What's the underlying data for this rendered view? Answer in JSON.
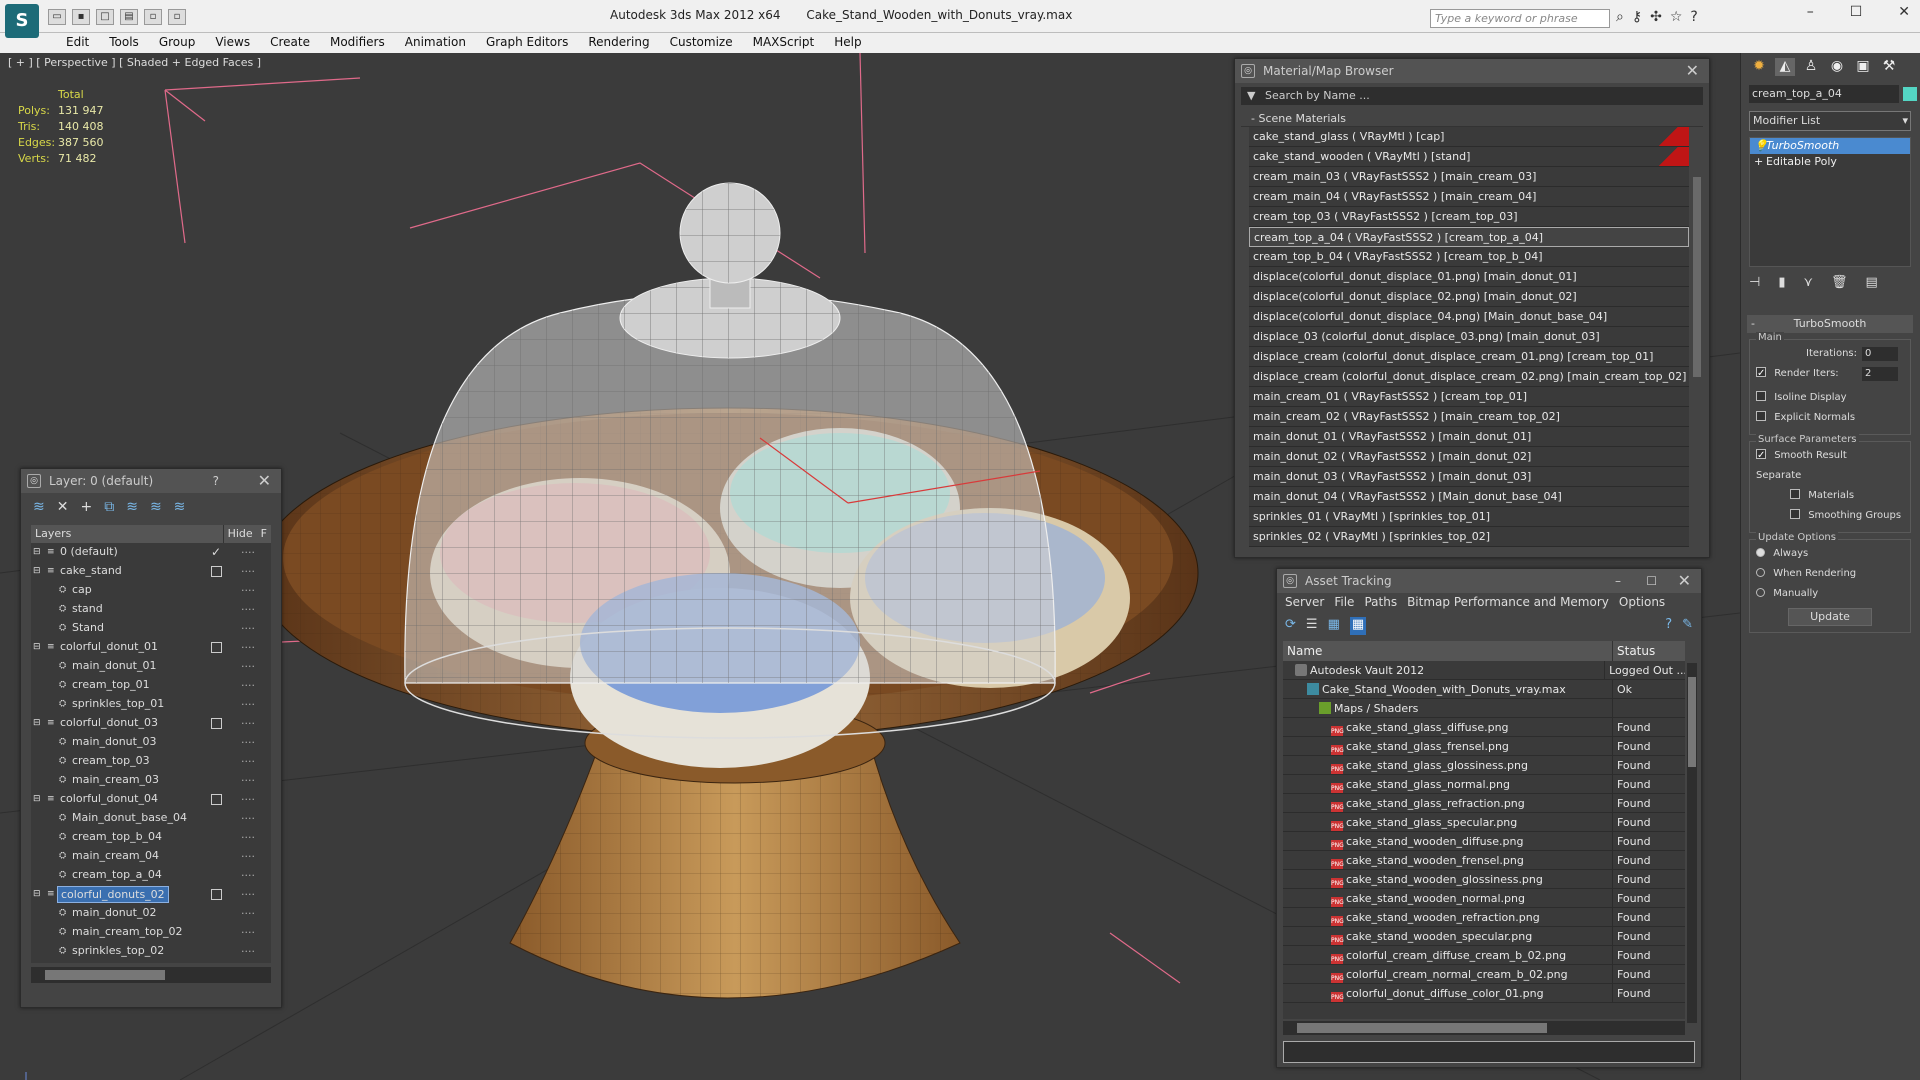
{
  "app": {
    "logo": "S",
    "title": "Autodesk 3ds Max  2012 x64",
    "file": "Cake_Stand_Wooden_with_Donuts_vray.max",
    "search_placeholder": "Type a keyword or phrase"
  },
  "menu": [
    "Edit",
    "Tools",
    "Group",
    "Views",
    "Create",
    "Modifiers",
    "Animation",
    "Graph Editors",
    "Rendering",
    "Customize",
    "MAXScript",
    "Help"
  ],
  "viewport": {
    "label": "[ + ] [ Perspective ] [ Shaded + Edged Faces ]",
    "stats_header": "Total",
    "stats": [
      {
        "key": "Polys:",
        "value": "131 947"
      },
      {
        "key": "Tris:",
        "value": "140 408"
      },
      {
        "key": "Edges:",
        "value": "387 560"
      },
      {
        "key": "Verts:",
        "value": "71 482"
      }
    ]
  },
  "material_browser": {
    "title": "Material/Map Browser",
    "search": "Search by Name ...",
    "section": "Scene Materials",
    "items": [
      "cake_stand_glass  ( VRayMtl )  [cap]",
      "cake_stand_wooden  ( VRayMtl )  [stand]",
      "cream_main_03  ( VRayFastSSS2 )  [main_cream_03]",
      "cream_main_04  ( VRayFastSSS2 )  [main_cream_04]",
      "cream_top_03  ( VRayFastSSS2 )  [cream_top_03]",
      "cream_top_a_04  ( VRayFastSSS2 )  [cream_top_a_04]",
      "cream_top_b_04  ( VRayFastSSS2 )  [cream_top_b_04]",
      "displace(colorful_donut_displace_01.png) [main_donut_01]",
      "displace(colorful_donut_displace_02.png) [main_donut_02]",
      "displace(colorful_donut_displace_04.png) [Main_donut_base_04]",
      "displace_03 (colorful_donut_displace_03.png) [main_donut_03]",
      "displace_cream (colorful_donut_displace_cream_01.png) [cream_top_01]",
      "displace_cream (colorful_donut_displace_cream_02.png) [main_cream_top_02]",
      "main_cream_01  ( VRayFastSSS2 )  [cream_top_01]",
      "main_cream_02  ( VRayFastSSS2 )  [main_cream_top_02]",
      "main_donut_01  ( VRayFastSSS2 )  [main_donut_01]",
      "main_donut_02  ( VRayFastSSS2 )  [main_donut_02]",
      "main_donut_03  ( VRayFastSSS2 )  [main_donut_03]",
      "main_donut_04  ( VRayFastSSS2 )  [Main_donut_base_04]",
      "sprinkles_01  ( VRayMtl )  [sprinkles_top_01]",
      "sprinkles_02  ( VRayMtl )  [sprinkles_top_02]"
    ]
  },
  "layers": {
    "title": "Layer: 0 (default)",
    "help": "?",
    "columns": [
      "Layers",
      "Hide",
      "F"
    ],
    "rows": [
      {
        "name": "0 (default)",
        "level": 0,
        "check": true
      },
      {
        "name": "cake_stand",
        "level": 0,
        "box": true
      },
      {
        "name": "cap",
        "level": 1
      },
      {
        "name": "stand",
        "level": 1
      },
      {
        "name": "Stand",
        "level": 1
      },
      {
        "name": "colorful_donut_01",
        "level": 0,
        "box": true
      },
      {
        "name": "main_donut_01",
        "level": 1
      },
      {
        "name": "cream_top_01",
        "level": 1
      },
      {
        "name": "sprinkles_top_01",
        "level": 1
      },
      {
        "name": "colorful_donut_03",
        "level": 0,
        "box": true
      },
      {
        "name": "main_donut_03",
        "level": 1
      },
      {
        "name": "cream_top_03",
        "level": 1
      },
      {
        "name": "main_cream_03",
        "level": 1
      },
      {
        "name": "colorful_donut_04",
        "level": 0,
        "box": true
      },
      {
        "name": "Main_donut_base_04",
        "level": 1
      },
      {
        "name": "cream_top_b_04",
        "level": 1
      },
      {
        "name": "main_cream_04",
        "level": 1
      },
      {
        "name": "cream_top_a_04",
        "level": 1
      },
      {
        "name": "colorful_donuts_02",
        "level": 0,
        "box": true,
        "selected": true
      },
      {
        "name": "main_donut_02",
        "level": 1
      },
      {
        "name": "main_cream_top_02",
        "level": 1
      },
      {
        "name": "sprinkles_top_02",
        "level": 1
      }
    ]
  },
  "asset_tracking": {
    "title": "Asset Tracking",
    "menu": [
      "Server",
      "File",
      "Paths",
      "Bitmap Performance and Memory",
      "Options"
    ],
    "columns": [
      "Name",
      "Status"
    ],
    "rows": [
      {
        "name": "Autodesk Vault 2012",
        "status": "Logged Out ...",
        "icon": "vault",
        "indent": 1
      },
      {
        "name": "Cake_Stand_Wooden_with_Donuts_vray.max",
        "status": "Ok",
        "icon": "max",
        "indent": 2
      },
      {
        "name": "Maps / Shaders",
        "status": "",
        "icon": "folder",
        "indent": 3
      },
      {
        "name": "cake_stand_glass_diffuse.png",
        "status": "Found",
        "icon": "png",
        "indent": 4
      },
      {
        "name": "cake_stand_glass_frensel.png",
        "status": "Found",
        "icon": "png",
        "indent": 4
      },
      {
        "name": "cake_stand_glass_glossiness.png",
        "status": "Found",
        "icon": "png",
        "indent": 4
      },
      {
        "name": "cake_stand_glass_normal.png",
        "status": "Found",
        "icon": "png",
        "indent": 4
      },
      {
        "name": "cake_stand_glass_refraction.png",
        "status": "Found",
        "icon": "png",
        "indent": 4
      },
      {
        "name": "cake_stand_glass_specular.png",
        "status": "Found",
        "icon": "png",
        "indent": 4
      },
      {
        "name": "cake_stand_wooden_diffuse.png",
        "status": "Found",
        "icon": "png",
        "indent": 4
      },
      {
        "name": "cake_stand_wooden_frensel.png",
        "status": "Found",
        "icon": "png",
        "indent": 4
      },
      {
        "name": "cake_stand_wooden_glossiness.png",
        "status": "Found",
        "icon": "png",
        "indent": 4
      },
      {
        "name": "cake_stand_wooden_normal.png",
        "status": "Found",
        "icon": "png",
        "indent": 4
      },
      {
        "name": "cake_stand_wooden_refraction.png",
        "status": "Found",
        "icon": "png",
        "indent": 4
      },
      {
        "name": "cake_stand_wooden_specular.png",
        "status": "Found",
        "icon": "png",
        "indent": 4
      },
      {
        "name": "colorful_cream_diffuse_cream_b_02.png",
        "status": "Found",
        "icon": "png",
        "indent": 4
      },
      {
        "name": "colorful_cream_normal_cream_b_02.png",
        "status": "Found",
        "icon": "png",
        "indent": 4
      },
      {
        "name": "colorful_donut_diffuse_color_01.png",
        "status": "Found",
        "icon": "png",
        "indent": 4
      }
    ]
  },
  "command_panel": {
    "object_name": "cream_top_a_04",
    "object_color": "#54d6c4",
    "modifier_list": "Modifier List",
    "stack": [
      {
        "name": "TurboSmooth",
        "selected": true
      },
      {
        "name": "Editable Poly",
        "selected": false
      }
    ],
    "rollout_title": "TurboSmooth",
    "main_group": "Main",
    "iterations_label": "Iterations:",
    "iterations_value": "0",
    "render_iters_label": "Render Iters:",
    "render_iters_value": "2",
    "isoline": "Isoline Display",
    "explicit_normals": "Explicit Normals",
    "surface_group": "Surface Parameters",
    "smooth_result": "Smooth Result",
    "separate": "Separate",
    "materials": "Materials",
    "smoothing_groups": "Smoothing Groups",
    "update_group": "Update Options",
    "always": "Always",
    "when_rendering": "When Rendering",
    "manually": "Manually",
    "update_button": "Update"
  }
}
